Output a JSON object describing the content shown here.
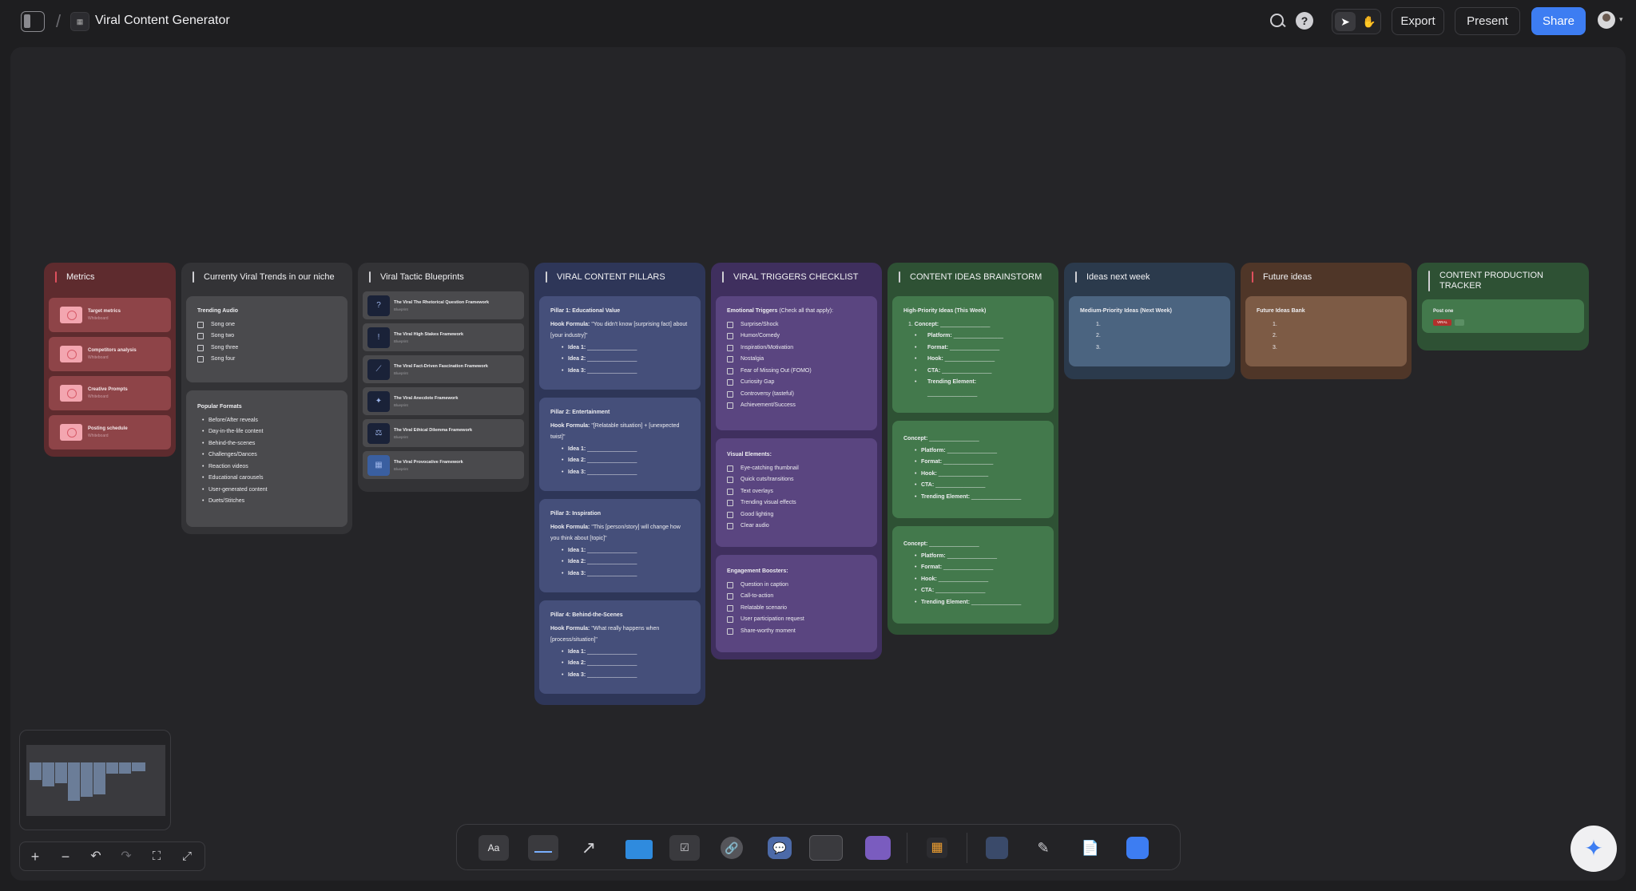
{
  "header": {
    "board_title": "Viral Content Generator",
    "export_label": "Export",
    "present_label": "Present",
    "share_label": "Share"
  },
  "columns": {
    "metrics": {
      "title": "Metrics",
      "items": [
        {
          "name": "Target metrics",
          "sub": "Whiteboard"
        },
        {
          "name": "Competitors analysis",
          "sub": "Whiteboard"
        },
        {
          "name": "Creative Prompts",
          "sub": "Whiteboard"
        },
        {
          "name": "Posting schedule",
          "sub": "Whiteboard"
        }
      ]
    },
    "trends": {
      "title": "Currenty Viral Trends in our niche",
      "audio_title": "Trending Audio",
      "songs": [
        "Song one",
        "Song two",
        "Song three",
        "Song four"
      ],
      "formats_title": "Popular Formats",
      "formats": [
        "Before/After reveals",
        "Day-in-the-life content",
        "Behind-the-scenes",
        "Challenges/Dances",
        "Reaction videos",
        "Educational carousels",
        "User-generated content",
        "Duets/Stitches"
      ]
    },
    "blueprints": {
      "title": "Viral Tactic Blueprints",
      "items": [
        {
          "name": "The Viral The Rhetorical Question Framework",
          "sub": "Blueprint"
        },
        {
          "name": "The Viral High Stakes Framework",
          "sub": "Blueprint"
        },
        {
          "name": "The Viral Fact-Driven Fascination Framework",
          "sub": "Blueprint"
        },
        {
          "name": "The Viral Anecdote Framework",
          "sub": "Blueprint"
        },
        {
          "name": "The Viral Ethical Dilemma Framework",
          "sub": "Blueprint"
        },
        {
          "name": "The Viral Provocative Framework",
          "sub": "Blueprint"
        }
      ]
    },
    "pillars": {
      "title": "VIRAL CONTENT PILLARS",
      "hook_label": "Hook Formula:",
      "idea1": "Idea 1:",
      "idea2": "Idea 2:",
      "idea3": "Idea 3:",
      "blank": "________________",
      "items": [
        {
          "title": "Pillar 1: Educational Value",
          "hook": "\"You didn't know [surprising fact] about [your industry]\""
        },
        {
          "title": "Pillar 2: Entertainment",
          "hook": "\"[Relatable situation] + [unexpected twist]\""
        },
        {
          "title": "Pillar 3: Inspiration",
          "hook": "\"This [person/story] will change how you think about [topic]\""
        },
        {
          "title": "Pillar 4: Behind-the-Scenes",
          "hook": "\"What really happens when [process/situation]\""
        }
      ]
    },
    "triggers": {
      "title": "VIRAL TRIGGERS CHECKLIST",
      "emotional_title": "Emotional Triggers",
      "emotional_note": " (Check all that apply):",
      "emotional": [
        "Surprise/Shock",
        "Humor/Comedy",
        "Inspiration/Motivation",
        "Nostalgia",
        "Fear of Missing Out (FOMO)",
        "Curiosity Gap",
        "Controversy (tasteful)",
        "Achievement/Success"
      ],
      "visual_title": "Visual Elements:",
      "visual": [
        "Eye-catching thumbnail",
        "Quick cuts/transitions",
        "Text overlays",
        "Trending visual effects",
        "Good lighting",
        "Clear audio"
      ],
      "engagement_title": "Engagement Boosters:",
      "engagement": [
        "Question in caption",
        "Call-to-action",
        "Relatable scenario",
        "User participation request",
        "Share-worthy moment"
      ]
    },
    "brainstorm": {
      "title": "CONTENT IDEAS BRAINSTORM",
      "high_title": "High-Priority Ideas (This Week)",
      "concept": "Concept:",
      "platform": "Platform:",
      "format": "Format:",
      "hook": "Hook:",
      "cta": "CTA:",
      "trending": "Trending Element:",
      "blank": "________________",
      "num1": "1."
    },
    "next_week": {
      "title": "Ideas next week",
      "card_title": "Medium-Priority Ideas (Next Week)",
      "nums": [
        "1.",
        "2.",
        "3."
      ]
    },
    "future": {
      "title": "Future ideas",
      "card_title": "Future Ideas Bank",
      "nums": [
        "1.",
        "2.",
        "3."
      ]
    },
    "tracker": {
      "title": "CONTENT PRODUCTION TRACKER",
      "card_title": "Post one",
      "tag": "VIRAL"
    }
  },
  "colors": {
    "accent": "#3d7df2",
    "metrics_bg": "#5e2b2e",
    "trends_bg": "#3b3b3e",
    "pillars_bg": "#2e3658",
    "triggers_bg": "#3f2f5e",
    "brainstorm_bg": "#2e5134",
    "next_week_bg": "#2b3a4c",
    "future_bg": "#4f3628"
  }
}
